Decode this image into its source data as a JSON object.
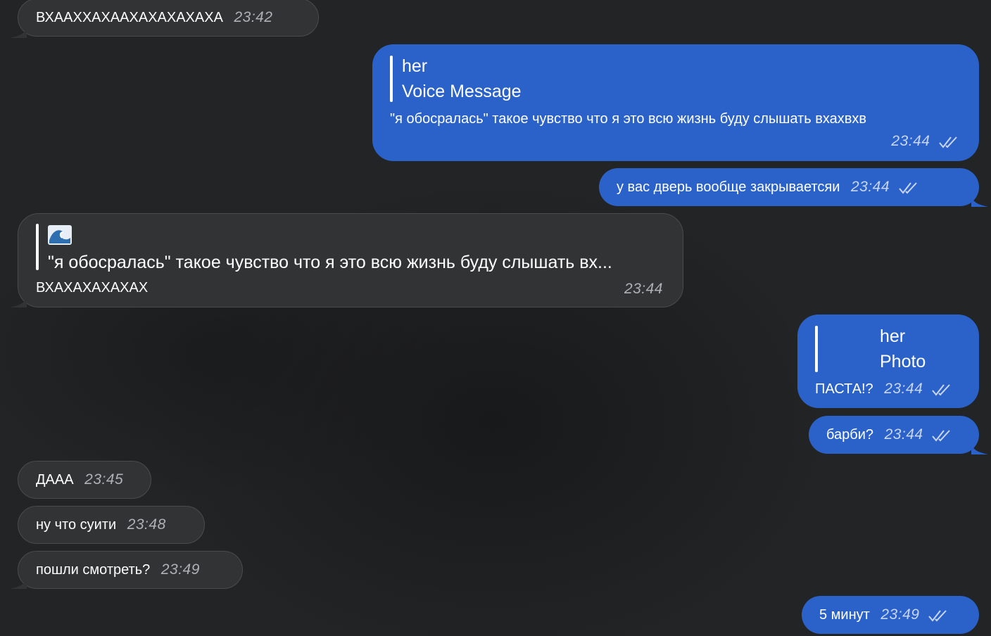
{
  "messages": [
    {
      "dir": "in",
      "text": "ВХААХХАХААХАХАХАХАХА",
      "time": "23:42"
    },
    {
      "dir": "out",
      "reply_author": "her",
      "reply_type": "Voice Message",
      "text": "\"я обосралась\" такое чувство что я это всю жизнь буду слышать вхахвхв",
      "time": "23:44",
      "read": true
    },
    {
      "dir": "out",
      "text": "у вас дверь вообще закрываетсяи",
      "time": "23:44",
      "read": true
    },
    {
      "dir": "in",
      "reply_icon": "water-wave-emoji",
      "reply_text": "\"я обосралась\" такое чувство что я это всю жизнь буду слышать вх...",
      "text": "ВХАХАХАХАХАХ",
      "time": "23:44"
    },
    {
      "dir": "out",
      "reply_author": "her",
      "reply_type": "Photo",
      "text": "ПАСТА!?",
      "time": "23:44",
      "read": true
    },
    {
      "dir": "out",
      "text": "барби?",
      "time": "23:44",
      "read": true
    },
    {
      "dir": "in",
      "text": "ДААА",
      "time": "23:45"
    },
    {
      "dir": "in",
      "text": "ну что суити",
      "time": "23:48"
    },
    {
      "dir": "in",
      "text": "пошли смотреть?",
      "time": "23:49"
    },
    {
      "dir": "out",
      "text": "5 минут",
      "time": "23:49",
      "read": true
    }
  ],
  "colors": {
    "background": "#222426",
    "incoming_bubble": "#323335",
    "outgoing_bubble": "#2b62c9",
    "timestamp_in": "#aeb1b5",
    "timestamp_out": "#c9d6f2"
  }
}
